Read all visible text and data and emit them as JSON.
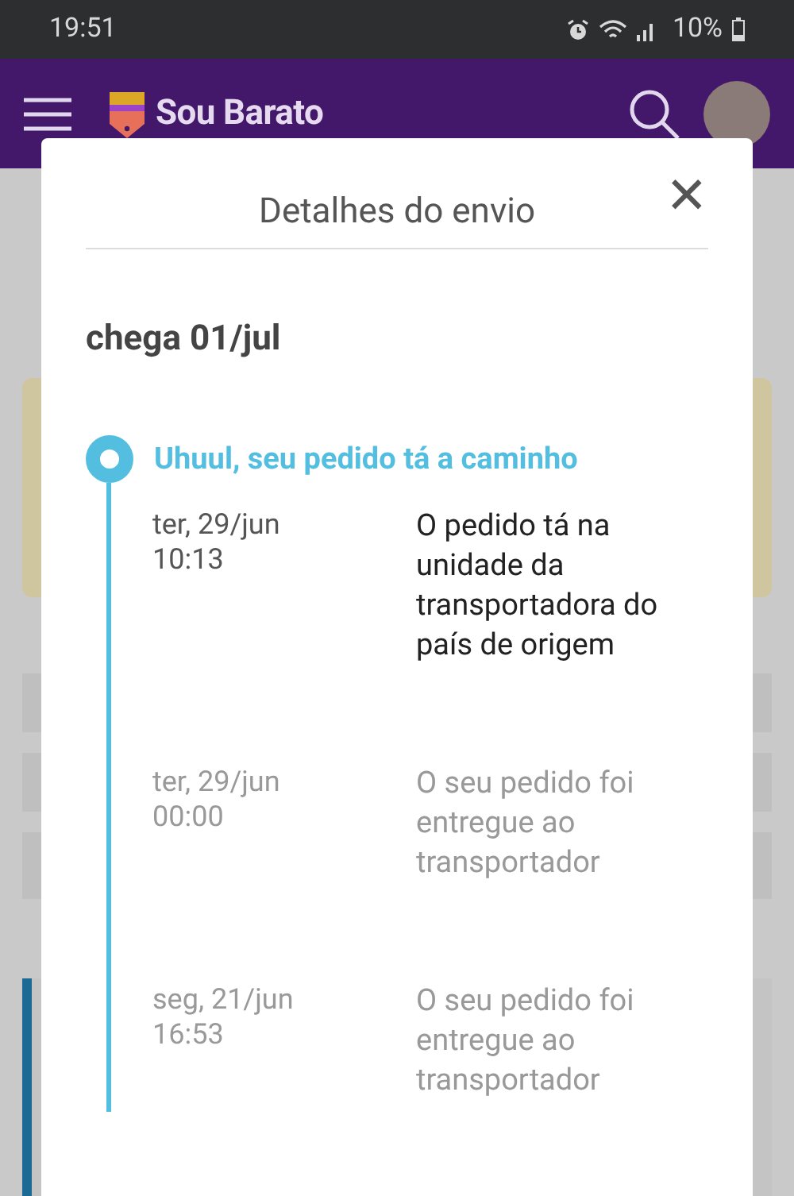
{
  "status_bar": {
    "time": "19:51",
    "battery": "10%"
  },
  "app_bar": {
    "logo_text": "Sou Barato"
  },
  "dialog": {
    "title": "Detalhes do envio",
    "close_glyph": "✕",
    "arrival": "chega 01/jul",
    "status": "Uhuul, seu pedido tá a caminho",
    "events": [
      {
        "date": "ter, 29/jun",
        "time": "10:13",
        "text": "O pedido tá na unidade da transportadora do país de origem",
        "current": true
      },
      {
        "date": "ter, 29/jun",
        "time": "00:00",
        "text": "O seu pedido foi entregue ao transportador",
        "current": false
      },
      {
        "date": "seg, 21/jun",
        "time": "16:53",
        "text": "O seu pedido foi entregue ao transportador",
        "current": false
      }
    ]
  }
}
